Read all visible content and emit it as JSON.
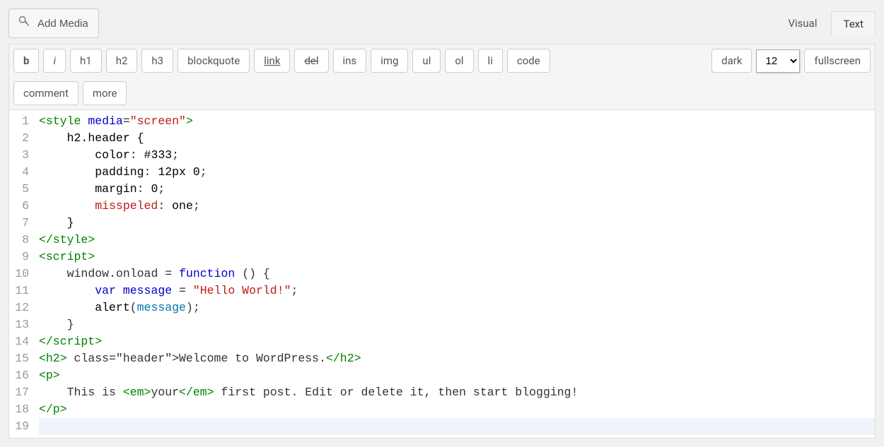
{
  "topbar": {
    "add_media_label": "Add Media"
  },
  "tabs": {
    "visual": "Visual",
    "text": "Text",
    "active": "text"
  },
  "toolbar": {
    "b": "b",
    "i": "i",
    "h1": "h1",
    "h2": "h2",
    "h3": "h3",
    "blockquote": "blockquote",
    "link": "link",
    "del": "del",
    "ins": "ins",
    "img": "img",
    "ul": "ul",
    "ol": "ol",
    "li": "li",
    "code": "code",
    "comment": "comment",
    "more": "more",
    "dark": "dark",
    "font_size": "12",
    "fullscreen": "fullscreen"
  },
  "editor": {
    "line_count": 19,
    "cursor_line": 19,
    "lines": [
      {
        "n": 1,
        "tokens": [
          {
            "t": "<style",
            "c": "tag"
          },
          {
            "t": " ",
            "c": "plain"
          },
          {
            "t": "media",
            "c": "attr-name"
          },
          {
            "t": "=",
            "c": "plain"
          },
          {
            "t": "\"screen\"",
            "c": "attr-val"
          },
          {
            "t": ">",
            "c": "tag"
          }
        ]
      },
      {
        "n": 2,
        "indent": 1,
        "tokens": [
          {
            "t": "h2.header {",
            "c": "sel"
          }
        ]
      },
      {
        "n": 3,
        "indent": 2,
        "tokens": [
          {
            "t": "color",
            "c": "prop"
          },
          {
            "t": ": ",
            "c": "plain"
          },
          {
            "t": "#333",
            "c": "val"
          },
          {
            "t": ";",
            "c": "plain"
          }
        ]
      },
      {
        "n": 4,
        "indent": 2,
        "tokens": [
          {
            "t": "padding",
            "c": "prop"
          },
          {
            "t": ": ",
            "c": "plain"
          },
          {
            "t": "12px 0",
            "c": "val"
          },
          {
            "t": ";",
            "c": "plain"
          }
        ]
      },
      {
        "n": 5,
        "indent": 2,
        "tokens": [
          {
            "t": "margin",
            "c": "prop"
          },
          {
            "t": ": ",
            "c": "plain"
          },
          {
            "t": "0",
            "c": "val"
          },
          {
            "t": ";",
            "c": "plain"
          }
        ]
      },
      {
        "n": 6,
        "indent": 2,
        "tokens": [
          {
            "t": "misspeled",
            "c": "err"
          },
          {
            "t": ": ",
            "c": "plain"
          },
          {
            "t": "one",
            "c": "val"
          },
          {
            "t": ";",
            "c": "plain"
          }
        ]
      },
      {
        "n": 7,
        "indent": 1,
        "tokens": [
          {
            "t": "}",
            "c": "sel"
          }
        ]
      },
      {
        "n": 8,
        "tokens": [
          {
            "t": "</style>",
            "c": "tag"
          }
        ]
      },
      {
        "n": 9,
        "tokens": [
          {
            "t": "<script>",
            "c": "tag"
          }
        ]
      },
      {
        "n": 10,
        "indent": 1,
        "tokens": [
          {
            "t": "window",
            "c": "plain"
          },
          {
            "t": ".",
            "c": "plain"
          },
          {
            "t": "onload",
            "c": "plain"
          },
          {
            "t": " = ",
            "c": "plain"
          },
          {
            "t": "function",
            "c": "kw"
          },
          {
            "t": " () {",
            "c": "plain"
          }
        ]
      },
      {
        "n": 11,
        "indent": 2,
        "tokens": [
          {
            "t": "var",
            "c": "kw"
          },
          {
            "t": " ",
            "c": "plain"
          },
          {
            "t": "message",
            "c": "def"
          },
          {
            "t": " = ",
            "c": "plain"
          },
          {
            "t": "\"Hello World!\"",
            "c": "str"
          },
          {
            "t": ";",
            "c": "plain"
          }
        ]
      },
      {
        "n": 12,
        "indent": 2,
        "tokens": [
          {
            "t": "alert",
            "c": "fn"
          },
          {
            "t": "(",
            "c": "plain"
          },
          {
            "t": "message",
            "c": "var"
          },
          {
            "t": ");",
            "c": "plain"
          }
        ]
      },
      {
        "n": 13,
        "indent": 1,
        "tokens": [
          {
            "t": "}",
            "c": "plain"
          }
        ]
      },
      {
        "n": 14,
        "tokens": [
          {
            "t": "</script>",
            "c": "tag"
          }
        ]
      },
      {
        "n": 15,
        "tokens": [
          {
            "t": "<h2>",
            "c": "tag"
          },
          {
            "t": " class=\"header\">Welcome to WordPress.",
            "c": "plain"
          },
          {
            "t": "</h2>",
            "c": "tag"
          }
        ]
      },
      {
        "n": 16,
        "tokens": [
          {
            "t": "<p>",
            "c": "tag"
          }
        ]
      },
      {
        "n": 17,
        "indent": 1,
        "tokens": [
          {
            "t": "This is ",
            "c": "plain"
          },
          {
            "t": "<em>",
            "c": "tag"
          },
          {
            "t": "your",
            "c": "plain"
          },
          {
            "t": "</em>",
            "c": "tag"
          },
          {
            "t": " first post. Edit or delete it, then start blogging!",
            "c": "plain"
          }
        ]
      },
      {
        "n": 18,
        "tokens": [
          {
            "t": "</p>",
            "c": "tag"
          }
        ]
      },
      {
        "n": 19,
        "tokens": []
      }
    ]
  }
}
